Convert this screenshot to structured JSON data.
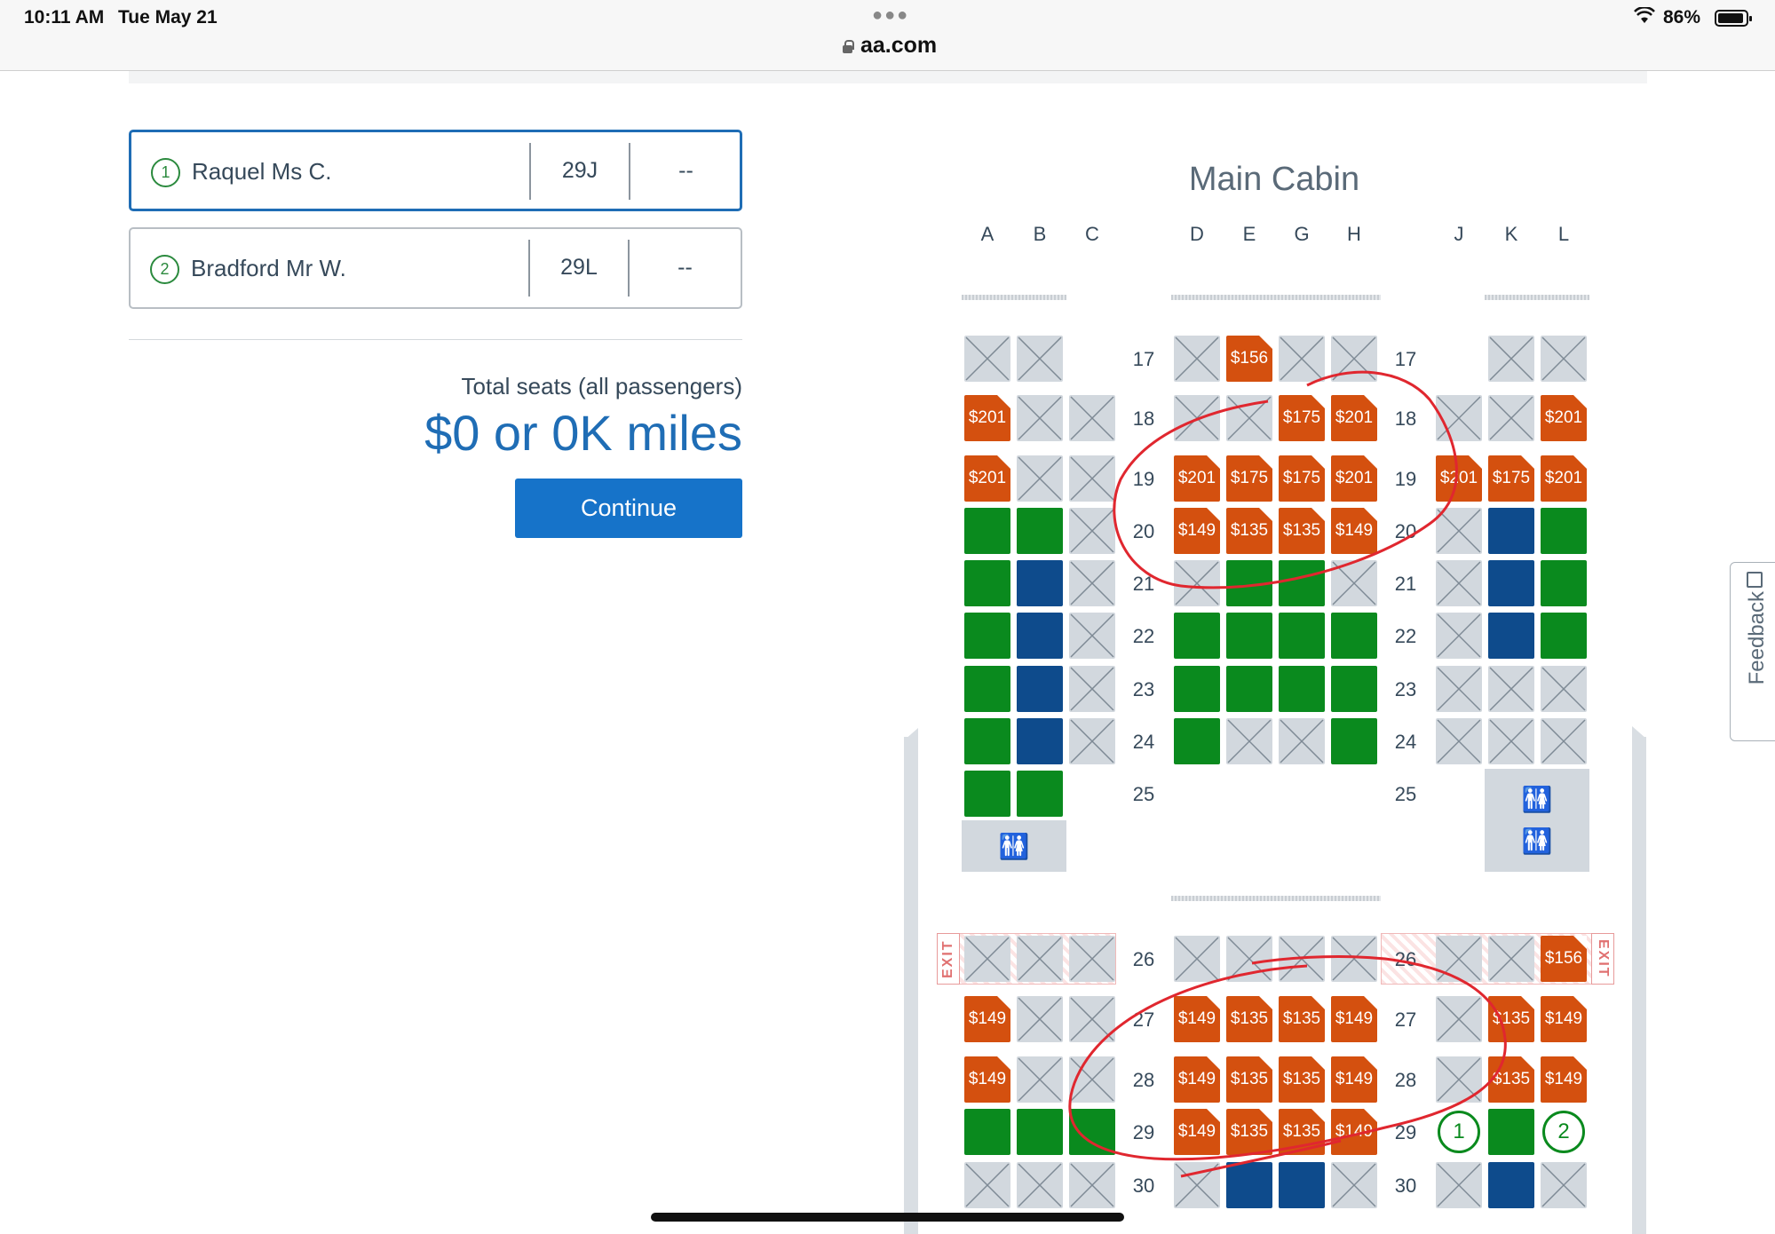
{
  "status_bar": {
    "time": "10:11 AM",
    "date": "Tue May 21",
    "url": "aa.com",
    "battery": "86%"
  },
  "passengers": [
    {
      "number": "1",
      "name": "Raquel Ms C.",
      "seat": "29J",
      "extra": "--",
      "active": true
    },
    {
      "number": "2",
      "name": "Bradford Mr W.",
      "seat": "29L",
      "extra": "--",
      "active": false
    }
  ],
  "summary": {
    "total_label": "Total seats (all passengers)",
    "total_value": "$0 or 0K miles",
    "continue_label": "Continue"
  },
  "seat_map": {
    "cabin_title": "Main Cabin",
    "columns": [
      "A",
      "B",
      "C",
      "D",
      "E",
      "G",
      "H",
      "J",
      "K",
      "L"
    ],
    "exit_label": "EXIT",
    "colors": {
      "orange": "#d4500f",
      "green": "#0a8a1e",
      "blue": "#0e4b8c",
      "unavailable": "#d2d8de"
    },
    "rows": [
      {
        "row": "17",
        "seats": [
          "x",
          "x",
          "-",
          "x",
          "$156",
          "x",
          "x",
          "-",
          "x",
          "x"
        ]
      },
      {
        "row": "18",
        "seats": [
          "$201",
          "x",
          "x",
          "x",
          "x",
          "$175",
          "$201",
          "x",
          "x",
          "$201"
        ]
      },
      {
        "row": "19",
        "seats": [
          "$201",
          "x",
          "x",
          "$201",
          "$175",
          "$175",
          "$201",
          "$201",
          "$175",
          "$201"
        ]
      },
      {
        "row": "20",
        "seats": [
          "g",
          "g",
          "x",
          "$149",
          "$135",
          "$135",
          "$149",
          "x",
          "b",
          "g"
        ]
      },
      {
        "row": "21",
        "seats": [
          "g",
          "b",
          "x",
          "x",
          "g",
          "g",
          "x",
          "x",
          "b",
          "g"
        ]
      },
      {
        "row": "22",
        "seats": [
          "g",
          "b",
          "x",
          "g",
          "g",
          "g",
          "g",
          "x",
          "b",
          "g"
        ]
      },
      {
        "row": "23",
        "seats": [
          "g",
          "b",
          "x",
          "g",
          "g",
          "g",
          "g",
          "x",
          "x",
          "x"
        ]
      },
      {
        "row": "24",
        "seats": [
          "g",
          "b",
          "x",
          "g",
          "x",
          "x",
          "g",
          "x",
          "x",
          "x"
        ]
      },
      {
        "row": "25",
        "seats": [
          "g",
          "g",
          "-",
          "-",
          "-",
          "-",
          "-",
          "-",
          "-",
          "-"
        ]
      },
      {
        "row": "26",
        "seats": [
          "x",
          "x",
          "x",
          "x",
          "x",
          "x",
          "x",
          "x",
          "x",
          "$156"
        ]
      },
      {
        "row": "27",
        "seats": [
          "$149",
          "x",
          "x",
          "$149",
          "$135",
          "$135",
          "$149",
          "x",
          "$135",
          "$149"
        ]
      },
      {
        "row": "28",
        "seats": [
          "$149",
          "x",
          "x",
          "$149",
          "$135",
          "$135",
          "$149",
          "x",
          "$135",
          "$149"
        ]
      },
      {
        "row": "29",
        "seats": [
          "g",
          "g",
          "g",
          "$149",
          "$135",
          "$135",
          "$149",
          "p1",
          "g",
          "p2"
        ]
      },
      {
        "row": "30",
        "seats": [
          "x",
          "x",
          "x",
          "x",
          "b",
          "b",
          "x",
          "x",
          "b",
          "x"
        ]
      }
    ]
  },
  "feedback_label": "Feedback"
}
